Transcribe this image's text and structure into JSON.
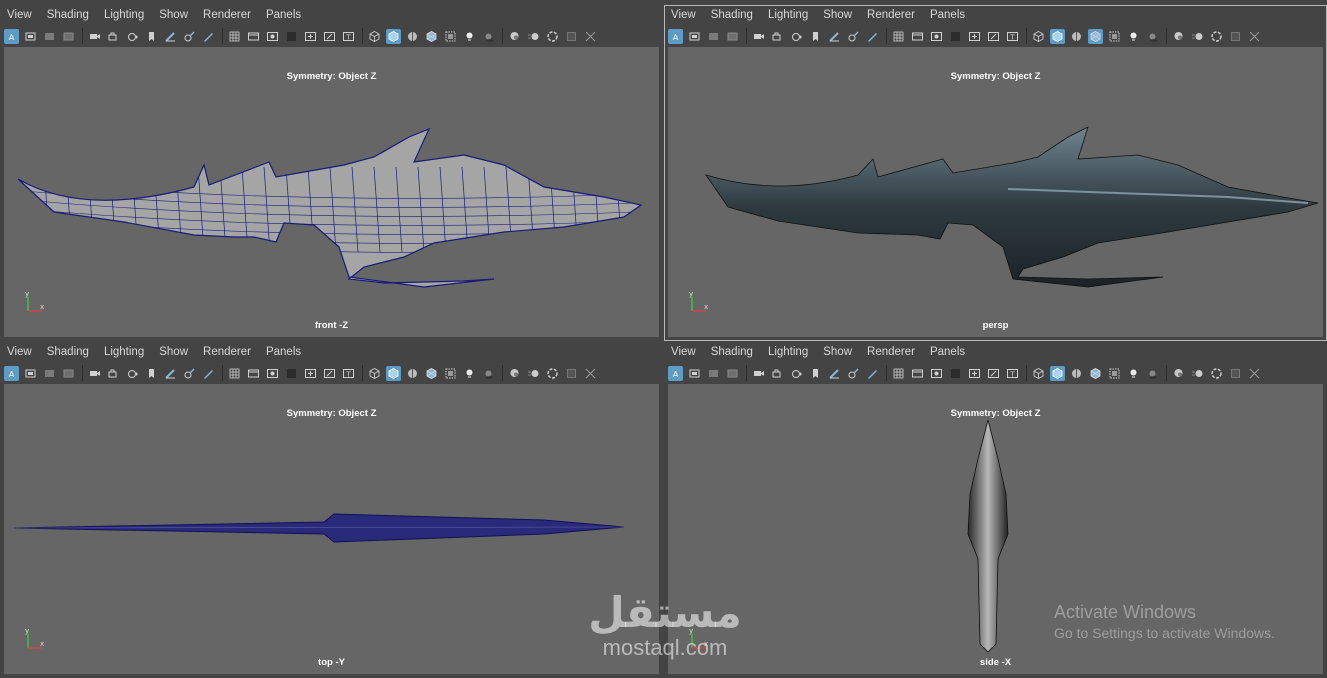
{
  "menus": [
    "View",
    "Shading",
    "Lighting",
    "Show",
    "Renderer",
    "Panels"
  ],
  "toolbar_icons": [
    "select-camera-icon",
    "camera-attributes-icon",
    "bookmarks-icon",
    "image-plane-icon",
    "separator",
    "camera-icon",
    "lock-camera-icon",
    "playblast-icon",
    "bookmark-icon",
    "grease-pencil-icon",
    "two-d-pan-icon",
    "pencil-icon",
    "separator",
    "grid-icon",
    "film-gate-icon",
    "resolution-gate-icon",
    "gate-mask-icon",
    "field-chart-icon",
    "safe-action-icon",
    "safe-title-icon",
    "separator",
    "wireframe-icon",
    "smooth-shade-icon",
    "shaded-wireframe-icon",
    "xray-icon",
    "backface-icon",
    "light-icon",
    "shadows-icon",
    "separator",
    "ambient-occlusion-icon",
    "motion-blur-icon",
    "anti-alias-icon",
    "isolate-select-icon",
    "xray-joints-icon"
  ],
  "panes": [
    {
      "id": "front",
      "symmetry": "Symmetry: Object Z",
      "camera": "front -Z",
      "active": false
    },
    {
      "id": "persp",
      "symmetry": "Symmetry: Object Z",
      "camera": "persp",
      "active": true
    },
    {
      "id": "top",
      "symmetry": "Symmetry: Object Z",
      "camera": "top -Y",
      "active": false
    },
    {
      "id": "side",
      "symmetry": "Symmetry: Object Z",
      "camera": "side -X",
      "active": false
    }
  ],
  "axis_labels": {
    "y": "y",
    "x": "x"
  },
  "watermark": {
    "arabic": "مستقل",
    "latin": "mostaql.com"
  },
  "activation": {
    "title": "Activate Windows",
    "subtitle": "Go to Settings to activate Windows."
  },
  "colors": {
    "viewport_bg": "#666666",
    "panel_bg": "#444444",
    "wire": "#1a1a7a",
    "active_icon": "#5d9cc7"
  }
}
